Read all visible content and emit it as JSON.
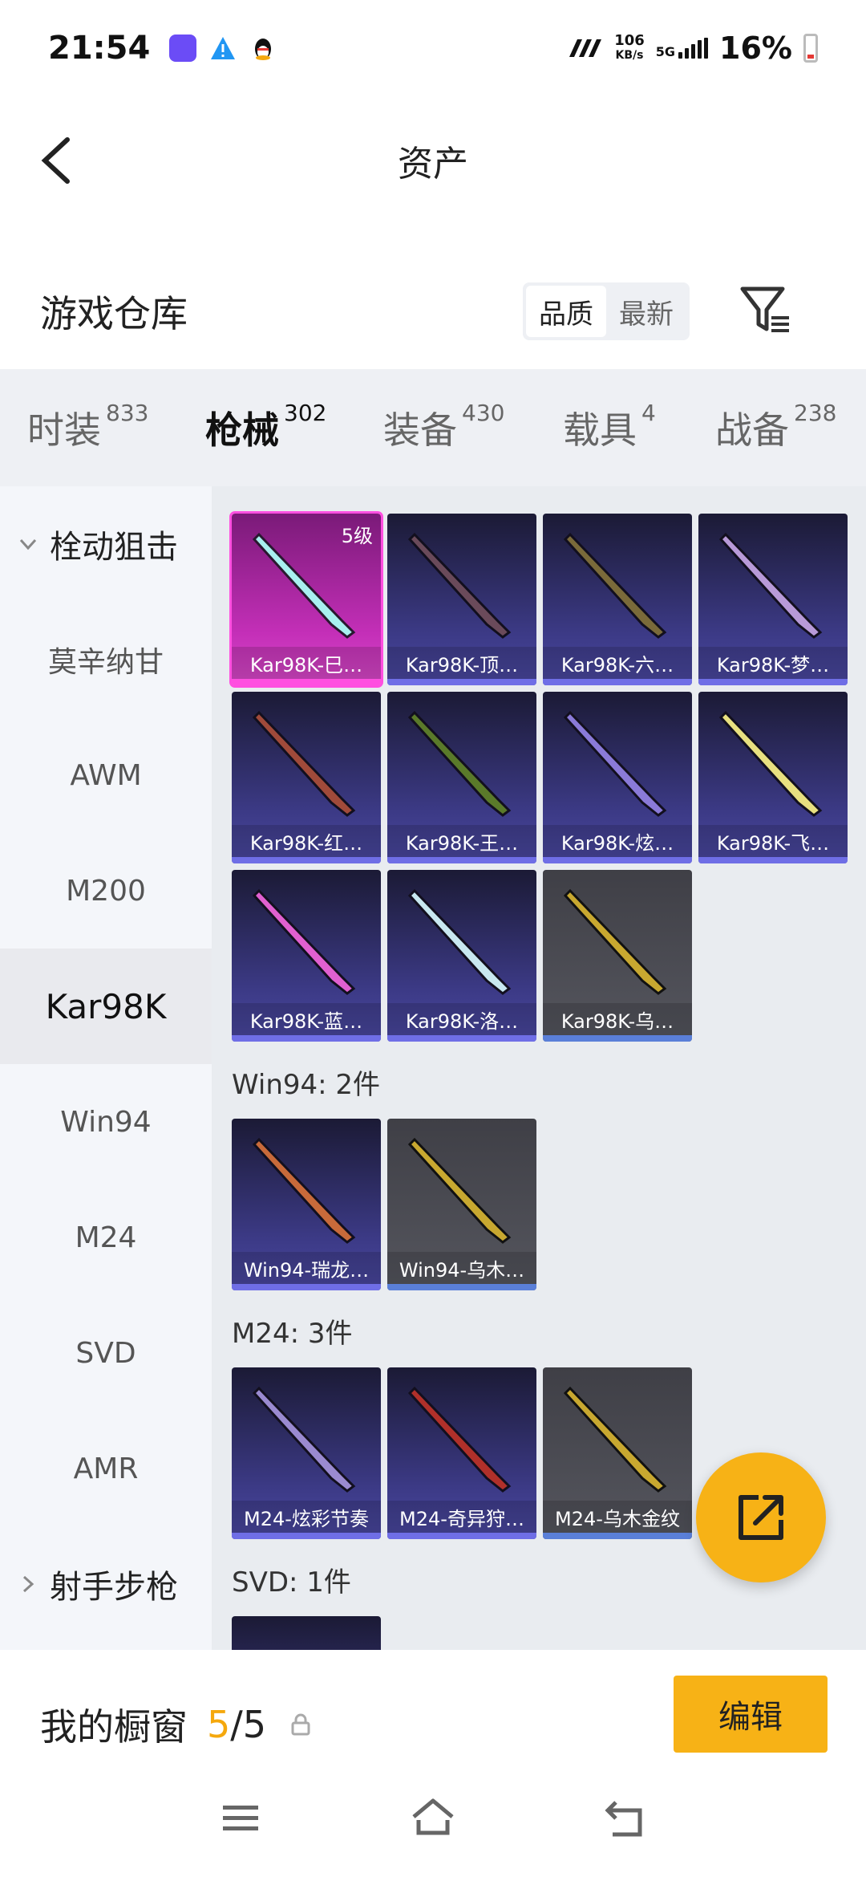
{
  "status": {
    "time": "21:54",
    "speed_value": "106",
    "speed_unit": "KB/s",
    "network": "5G",
    "battery": "16%"
  },
  "header": {
    "title": "资产"
  },
  "warehouse": {
    "title": "游戏仓库",
    "sort_options": [
      "品质",
      "最新"
    ],
    "sort_selected": "品质"
  },
  "tabs": [
    {
      "label": "时装",
      "count": "833"
    },
    {
      "label": "枪械",
      "count": "302"
    },
    {
      "label": "装备",
      "count": "430"
    },
    {
      "label": "载具",
      "count": "4"
    },
    {
      "label": "战备",
      "count": "238"
    }
  ],
  "active_tab": "枪械",
  "sidebar": {
    "groups": [
      "栓动狙击",
      "射手步枪"
    ],
    "items": [
      "莫辛纳甘",
      "AWM",
      "M200",
      "Kar98K",
      "Win94",
      "M24",
      "SVD",
      "AMR"
    ],
    "active_item": "Kar98K"
  },
  "sections": {
    "kar98k_cards": [
      {
        "label": "Kar98K-巳…",
        "level": "5级"
      },
      {
        "label": "Kar98K-顶…"
      },
      {
        "label": "Kar98K-六…"
      },
      {
        "label": "Kar98K-梦…"
      },
      {
        "label": "Kar98K-红…"
      },
      {
        "label": "Kar98K-王…"
      },
      {
        "label": "Kar98K-炫…"
      },
      {
        "label": "Kar98K-飞…"
      },
      {
        "label": "Kar98K-蓝…"
      },
      {
        "label": "Kar98K-洛…"
      },
      {
        "label": "Kar98K-乌…"
      }
    ],
    "win94_title": "Win94: 2件",
    "win94_cards": [
      {
        "label": "Win94-瑞龙…"
      },
      {
        "label": "Win94-乌木…"
      }
    ],
    "m24_title": "M24: 3件",
    "m24_cards": [
      {
        "label": "M24-炫彩节奏"
      },
      {
        "label": "M24-奇异狩…"
      },
      {
        "label": "M24-乌木金纹"
      }
    ],
    "svd_title": "SVD: 1件"
  },
  "bottom": {
    "showcase_label": "我的橱窗",
    "showcase_used": "5",
    "showcase_total": "/5",
    "edit_label": "编辑"
  },
  "colors": {
    "accent": "#f7b216",
    "tab_underline": "#f5a80d",
    "card_purple": "#3c3a86",
    "card_pink": "#c42fb8",
    "card_grey": "#55565e"
  }
}
